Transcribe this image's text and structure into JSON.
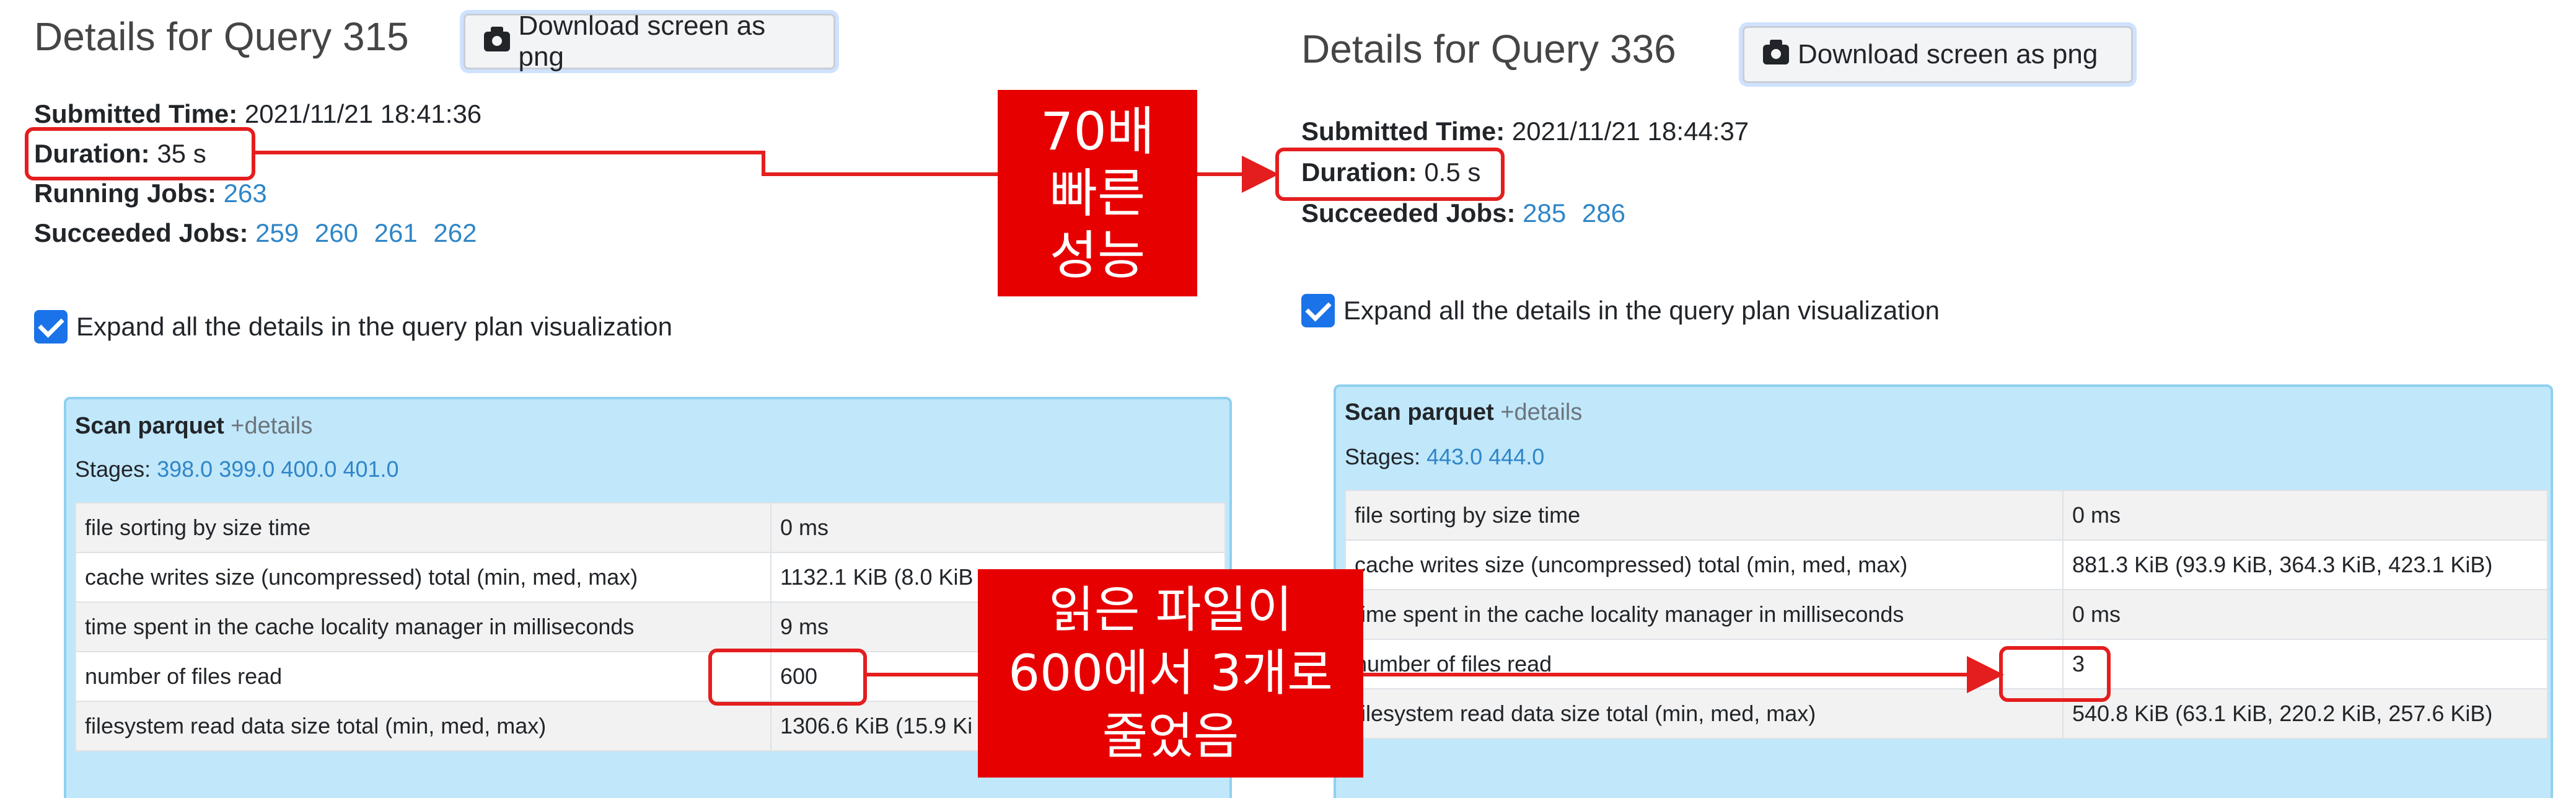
{
  "left": {
    "title": "Details for Query 315",
    "download_label": "Download screen as png",
    "submitted_label": "Submitted Time:",
    "submitted_value": "2021/11/21 18:41:36",
    "duration_label": "Duration:",
    "duration_value": "35 s",
    "running_label": "Running Jobs:",
    "running_jobs": [
      "263"
    ],
    "succeeded_label": "Succeeded Jobs:",
    "succeeded_jobs": [
      "259",
      "260",
      "261",
      "262"
    ],
    "expand_label": "Expand all the details in the query plan visualization",
    "node_title": "Scan parquet",
    "node_details": "+details",
    "stages_label": "Stages:",
    "stages": [
      "398.0",
      "399.0",
      "400.0",
      "401.0"
    ],
    "metrics": [
      {
        "name": "file sorting by size time",
        "value": "0 ms"
      },
      {
        "name": "cache writes size (uncompressed) total (min, med, max)",
        "value": "1132.1 KiB (8.0 KiB"
      },
      {
        "name": "time spent in the cache locality manager in milliseconds",
        "value": "9 ms"
      },
      {
        "name": "number of files read",
        "value": "600"
      },
      {
        "name": "filesystem read data size total (min, med, max)",
        "value": "1306.6 KiB (15.9 Ki"
      }
    ]
  },
  "right": {
    "title": "Details for Query 336",
    "download_label": "Download screen as png",
    "submitted_label": "Submitted Time:",
    "submitted_value": "2021/11/21 18:44:37",
    "duration_label": "Duration:",
    "duration_value": "0.5 s",
    "succeeded_label": "Succeeded Jobs:",
    "succeeded_jobs": [
      "285",
      "286"
    ],
    "expand_label": "Expand all the details in the query plan visualization",
    "node_title": "Scan parquet",
    "node_details": "+details",
    "stages_label": "Stages:",
    "stages": [
      "443.0",
      "444.0"
    ],
    "metrics": [
      {
        "name": "file sorting by size time",
        "value": "0 ms"
      },
      {
        "name": "cache writes size (uncompressed) total (min, med, max)",
        "value": "881.3 KiB (93.9 KiB, 364.3 KiB, 423.1 KiB)"
      },
      {
        "name": "time spent in the cache locality manager in milliseconds",
        "value": "0 ms"
      },
      {
        "name": "number of files read",
        "value": "3"
      },
      {
        "name": "filesystem read data size total (min, med, max)",
        "value": "540.8 KiB (63.1 KiB, 220.2 KiB, 257.6 KiB)"
      }
    ]
  },
  "callouts": {
    "speed": [
      "70배",
      "빠른",
      "성능"
    ],
    "files": [
      "읽은 파일이",
      "600에서 3개로",
      "줄었음"
    ]
  },
  "colors": {
    "accent_red": "#e60000",
    "link_blue": "#2f86c8",
    "node_bg": "#c1e7fa",
    "checkbox_blue": "#1a73e8"
  }
}
